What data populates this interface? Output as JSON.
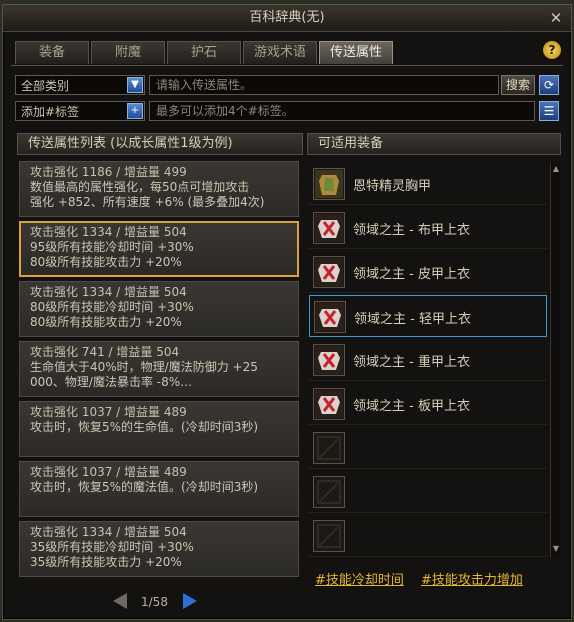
{
  "window": {
    "title": "百科辞典(无)"
  },
  "tabs": [
    {
      "label": "装备"
    },
    {
      "label": "附魔"
    },
    {
      "label": "护石"
    },
    {
      "label": "游戏术语"
    },
    {
      "label": "传送属性",
      "active": true
    }
  ],
  "filters": {
    "category_value": "全部类别",
    "search_placeholder": "请输入传送属性。",
    "search_label": "搜索",
    "tag_value": "添加#标签",
    "tag_placeholder": "最多可以添加4个#标签。"
  },
  "left_panel": {
    "title": "传送属性列表 (以成长属性1级为例)",
    "items": [
      {
        "l1": "攻击强化 1186 / 增益量 499",
        "l2": "数值最高的属性强化，每50点可增加攻击",
        "l3": "强化 +852、所有速度 +6% (最多叠加4次)"
      },
      {
        "l1": "攻击强化 1334 / 增益量 504",
        "l2": "95级所有技能冷却时间 +30%",
        "l3": "80级所有技能攻击力 +20%",
        "selected": true
      },
      {
        "l1": "攻击强化 1334 / 增益量 504",
        "l2": "80级所有技能冷却时间 +30%",
        "l3": "80级所有技能攻击力 +20%"
      },
      {
        "l1": "攻击强化 741 / 增益量 504",
        "l2": "生命值大于40%时，物理/魔法防御力 +25",
        "l3": "000、物理/魔法暴击率 -8%…"
      },
      {
        "l1": "攻击强化 1037 / 增益量 489",
        "l2": "攻击时，恢复5%的生命值。(冷却时间3秒)",
        "l3": ""
      },
      {
        "l1": "攻击强化 1037 / 增益量 489",
        "l2": "攻击时，恢复5%的魔法值。(冷却时间3秒)",
        "l3": ""
      },
      {
        "l1": "攻击强化 1334 / 增益量 504",
        "l2": "35级所有技能冷却时间 +30%",
        "l3": "35级所有技能攻击力 +20%"
      }
    ],
    "pager": "1/58"
  },
  "right_panel": {
    "title": "可适用装备",
    "items": [
      {
        "name": "恩特精灵胸甲",
        "icon": "chest-armor-icon"
      },
      {
        "name": "领域之主 - 布甲上衣",
        "icon": "cloth-top-icon"
      },
      {
        "name": "领域之主 - 皮甲上衣",
        "icon": "leather-top-icon"
      },
      {
        "name": "领域之主 - 轻甲上衣",
        "icon": "light-top-icon",
        "selected": true
      },
      {
        "name": "领域之主 - 重甲上衣",
        "icon": "heavy-top-icon"
      },
      {
        "name": "领域之主 - 板甲上衣",
        "icon": "plate-top-icon"
      }
    ],
    "tags": [
      "#技能冷却时间",
      "#技能攻击力增加"
    ]
  },
  "colors": {
    "accent_gold": "#e6b532",
    "selected_border": "#d9a23a",
    "equip_select": "#3a9bd8"
  }
}
